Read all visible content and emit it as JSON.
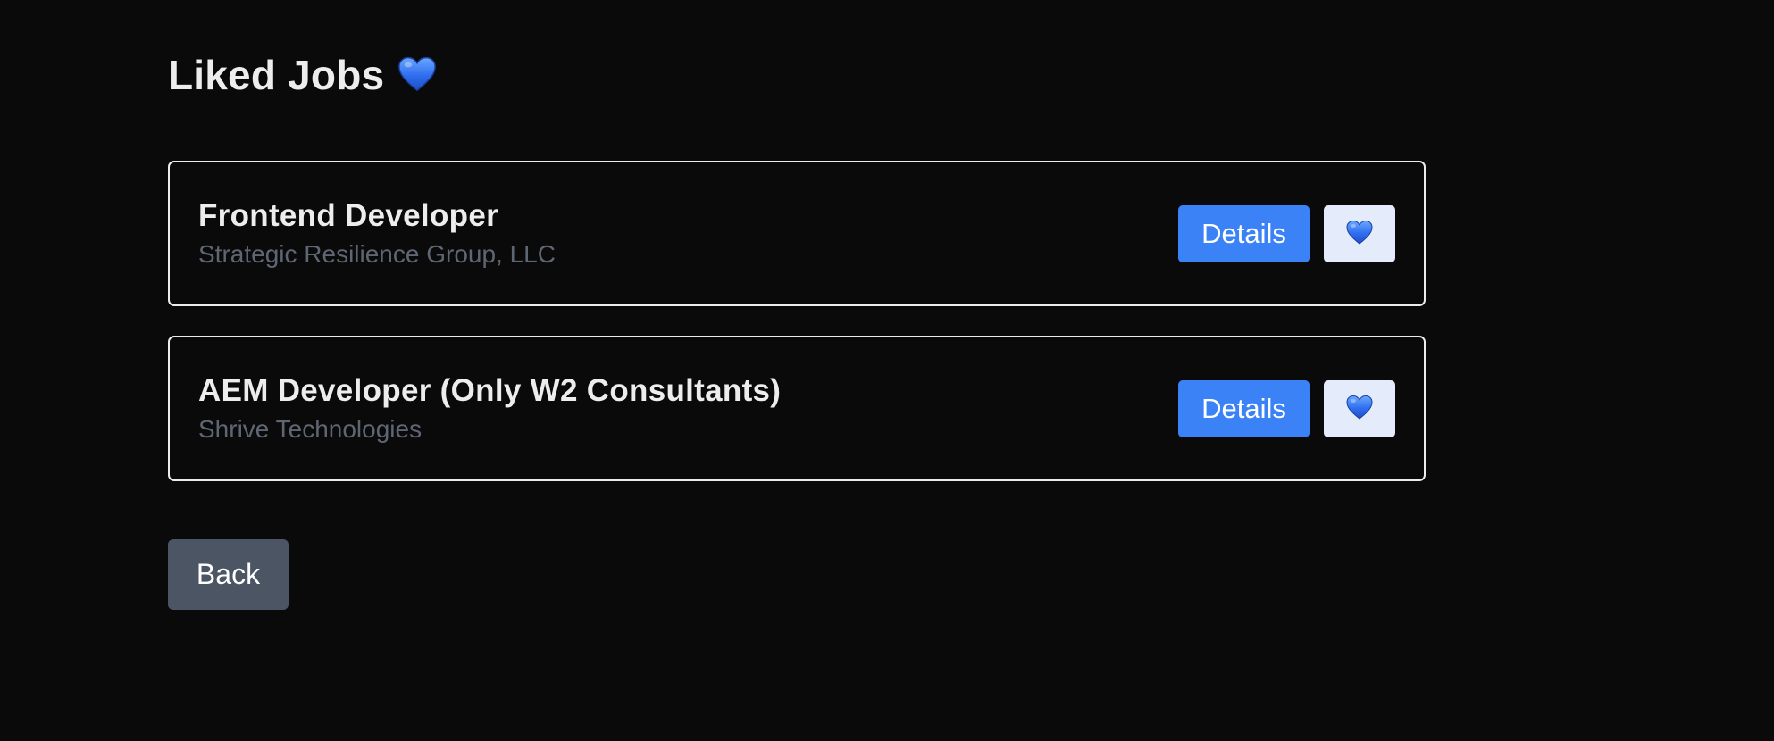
{
  "header": {
    "title": "Liked Jobs",
    "title_icon": "blue-heart-icon"
  },
  "jobs": [
    {
      "title": "Frontend Developer",
      "company": "Strategic Resilience Group, LLC",
      "details_label": "Details",
      "like_icon": "blue-heart-icon"
    },
    {
      "title": "AEM Developer (Only W2 Consultants)",
      "company": "Shrive Technologies",
      "details_label": "Details",
      "like_icon": "blue-heart-icon"
    }
  ],
  "footer": {
    "back_label": "Back"
  },
  "colors": {
    "background": "#0a0a0a",
    "primary_button": "#3b82f6",
    "like_button_bg": "#e4ecfb",
    "back_button": "#4b5563",
    "company_text": "#5f6673",
    "heart": "#3b82f6"
  }
}
